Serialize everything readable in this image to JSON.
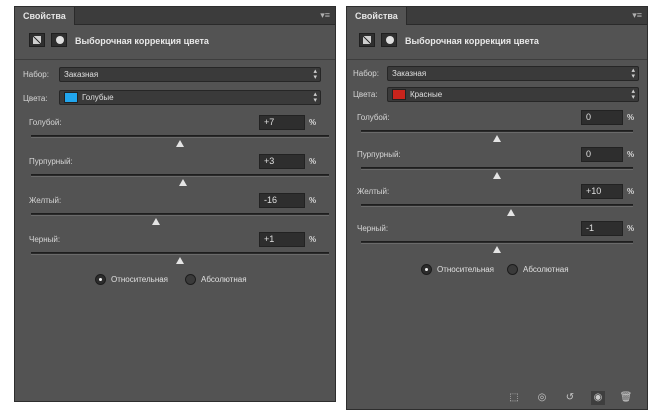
{
  "panel_left": {
    "tab_title": "Свойства",
    "header_title": "Выборочная коррекция цвета",
    "preset_label": "Набор:",
    "preset_value": "Заказная",
    "colors_label": "Цвета:",
    "colors_value": "Голубые",
    "colors_swatch": "#21a6ee",
    "sliders": [
      {
        "label": "Голубой:",
        "value": "+7",
        "percent": "%",
        "position": 0.5
      },
      {
        "label": "Пурпурный:",
        "value": "+3",
        "percent": "%",
        "position": 0.51
      },
      {
        "label": "Желтый:",
        "value": "-16",
        "percent": "%",
        "position": 0.42
      },
      {
        "label": "Черный:",
        "value": "+1",
        "percent": "%",
        "position": 0.5
      }
    ],
    "radio_relative": "Относительная",
    "radio_absolute": "Абсолютная",
    "selected_mode": "relative"
  },
  "panel_right": {
    "tab_title": "Свойства",
    "header_title": "Выборочная коррекция цвета",
    "preset_label": "Набор:",
    "preset_value": "Заказная",
    "colors_label": "Цвета:",
    "colors_value": "Красные",
    "colors_swatch": "#c8241c",
    "sliders": [
      {
        "label": "Голубой:",
        "value": "0",
        "percent": "%",
        "position": 0.5
      },
      {
        "label": "Пурпурный:",
        "value": "0",
        "percent": "%",
        "position": 0.5
      },
      {
        "label": "Желтый:",
        "value": "+10",
        "percent": "%",
        "position": 0.55
      },
      {
        "label": "Черный:",
        "value": "-1",
        "percent": "%",
        "position": 0.5
      }
    ],
    "radio_relative": "Относительная",
    "radio_absolute": "Абсолютная",
    "selected_mode": "relative",
    "footer_icons": [
      "clip-to-layer-icon",
      "view-previous-state-icon",
      "reset-icon",
      "visibility-eye-icon",
      "trash-icon"
    ]
  }
}
